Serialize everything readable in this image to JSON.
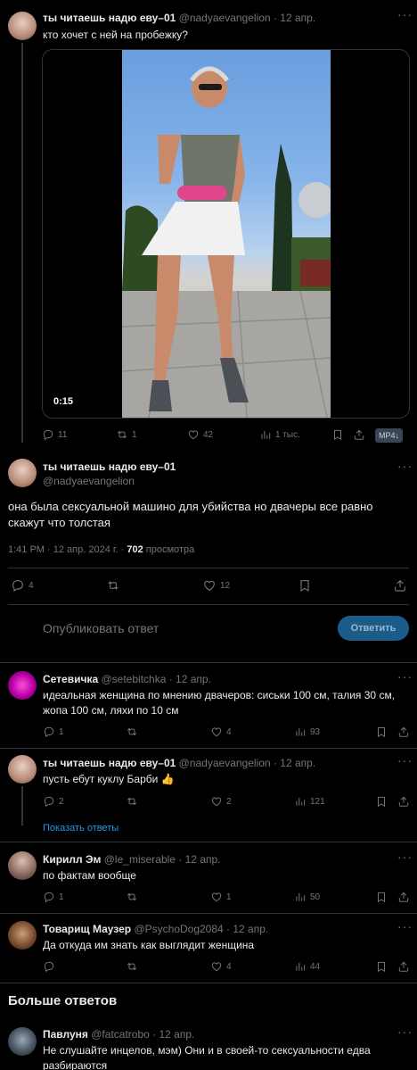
{
  "tweet1": {
    "name": "ты читаешь надю еву–01",
    "handle": "@nadyaevangelion",
    "date": "· 12 апр.",
    "text": "кто хочет с ней на пробежку?",
    "video_time": "0:15",
    "replies": "11",
    "retweets": "1",
    "likes": "42",
    "views": "1 тыс.",
    "badge": "MP4↓"
  },
  "main": {
    "name": "ты читаешь надю еву–01",
    "handle": "@nadyaevangelion",
    "text": "она была сексуальной машино для убийства но двачеры все равно скажут что толстая",
    "meta_time": "1:41 PM · 12 апр. 2024 г. · ",
    "views_count": "702",
    "views_label": " просмотра",
    "replies": "4",
    "likes": "12"
  },
  "reply_box": {
    "placeholder": "Опубликовать ответ",
    "button": "Ответить"
  },
  "replies": [
    {
      "name": "Сетевичка",
      "handle": "@setebitchka",
      "date": "· 12 апр.",
      "text": "идеальная женщина по мнению двачеров: сиськи 100 см, талия 30 см, жопа 100 см, ляхи по 10 см",
      "replies": "1",
      "retweets": "",
      "likes": "4",
      "views": "93"
    },
    {
      "name": "ты читаешь надю еву–01",
      "handle": "@nadyaevangelion",
      "date": "· 12 апр.",
      "text": "пусть ебут куклу Барби",
      "emoji": "👍",
      "replies": "2",
      "retweets": "",
      "likes": "2",
      "views": "121",
      "show_replies": "Показать ответы"
    },
    {
      "name": "Кирилл Эм",
      "handle": "@le_miserable",
      "date": "· 12 апр.",
      "text": "по фактам вообще",
      "replies": "1",
      "retweets": "",
      "likes": "1",
      "views": "50"
    },
    {
      "name": "Товарищ Маузер",
      "handle": "@PsychoDog2084",
      "date": "· 12 апр.",
      "text": "Да откуда им знать как выглядит женщина",
      "replies": "",
      "retweets": "",
      "likes": "4",
      "views": "44"
    }
  ],
  "more_replies_heading": "Больше ответов",
  "reply5": {
    "name": "Павлуня",
    "handle": "@fatcatrobo",
    "date": "· 12 апр.",
    "text": "Не слушайте инцелов, мэм) Они и в своей-то сексуальности едва разбираются"
  },
  "colors": {
    "accent": "#1d9bf0",
    "reply_button_bg": "#1a5c8a",
    "background": "#000000",
    "border": "#2f3336",
    "muted": "#71767b"
  }
}
